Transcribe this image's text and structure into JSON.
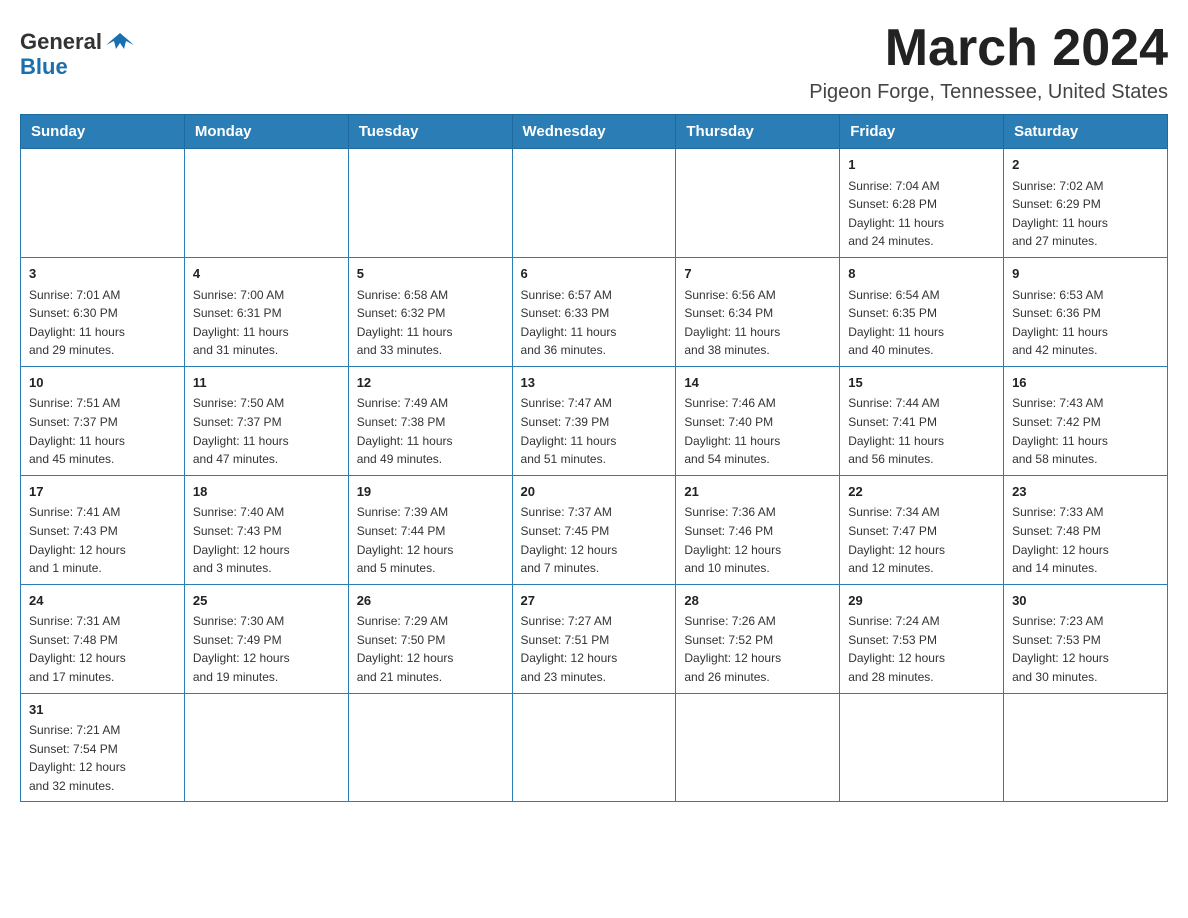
{
  "header": {
    "logo_general": "General",
    "logo_blue": "Blue",
    "month_title": "March 2024",
    "location": "Pigeon Forge, Tennessee, United States"
  },
  "weekdays": [
    "Sunday",
    "Monday",
    "Tuesday",
    "Wednesday",
    "Thursday",
    "Friday",
    "Saturday"
  ],
  "weeks": [
    [
      {
        "day": "",
        "info": ""
      },
      {
        "day": "",
        "info": ""
      },
      {
        "day": "",
        "info": ""
      },
      {
        "day": "",
        "info": ""
      },
      {
        "day": "",
        "info": ""
      },
      {
        "day": "1",
        "info": "Sunrise: 7:04 AM\nSunset: 6:28 PM\nDaylight: 11 hours\nand 24 minutes."
      },
      {
        "day": "2",
        "info": "Sunrise: 7:02 AM\nSunset: 6:29 PM\nDaylight: 11 hours\nand 27 minutes."
      }
    ],
    [
      {
        "day": "3",
        "info": "Sunrise: 7:01 AM\nSunset: 6:30 PM\nDaylight: 11 hours\nand 29 minutes."
      },
      {
        "day": "4",
        "info": "Sunrise: 7:00 AM\nSunset: 6:31 PM\nDaylight: 11 hours\nand 31 minutes."
      },
      {
        "day": "5",
        "info": "Sunrise: 6:58 AM\nSunset: 6:32 PM\nDaylight: 11 hours\nand 33 minutes."
      },
      {
        "day": "6",
        "info": "Sunrise: 6:57 AM\nSunset: 6:33 PM\nDaylight: 11 hours\nand 36 minutes."
      },
      {
        "day": "7",
        "info": "Sunrise: 6:56 AM\nSunset: 6:34 PM\nDaylight: 11 hours\nand 38 minutes."
      },
      {
        "day": "8",
        "info": "Sunrise: 6:54 AM\nSunset: 6:35 PM\nDaylight: 11 hours\nand 40 minutes."
      },
      {
        "day": "9",
        "info": "Sunrise: 6:53 AM\nSunset: 6:36 PM\nDaylight: 11 hours\nand 42 minutes."
      }
    ],
    [
      {
        "day": "10",
        "info": "Sunrise: 7:51 AM\nSunset: 7:37 PM\nDaylight: 11 hours\nand 45 minutes."
      },
      {
        "day": "11",
        "info": "Sunrise: 7:50 AM\nSunset: 7:37 PM\nDaylight: 11 hours\nand 47 minutes."
      },
      {
        "day": "12",
        "info": "Sunrise: 7:49 AM\nSunset: 7:38 PM\nDaylight: 11 hours\nand 49 minutes."
      },
      {
        "day": "13",
        "info": "Sunrise: 7:47 AM\nSunset: 7:39 PM\nDaylight: 11 hours\nand 51 minutes."
      },
      {
        "day": "14",
        "info": "Sunrise: 7:46 AM\nSunset: 7:40 PM\nDaylight: 11 hours\nand 54 minutes."
      },
      {
        "day": "15",
        "info": "Sunrise: 7:44 AM\nSunset: 7:41 PM\nDaylight: 11 hours\nand 56 minutes."
      },
      {
        "day": "16",
        "info": "Sunrise: 7:43 AM\nSunset: 7:42 PM\nDaylight: 11 hours\nand 58 minutes."
      }
    ],
    [
      {
        "day": "17",
        "info": "Sunrise: 7:41 AM\nSunset: 7:43 PM\nDaylight: 12 hours\nand 1 minute."
      },
      {
        "day": "18",
        "info": "Sunrise: 7:40 AM\nSunset: 7:43 PM\nDaylight: 12 hours\nand 3 minutes."
      },
      {
        "day": "19",
        "info": "Sunrise: 7:39 AM\nSunset: 7:44 PM\nDaylight: 12 hours\nand 5 minutes."
      },
      {
        "day": "20",
        "info": "Sunrise: 7:37 AM\nSunset: 7:45 PM\nDaylight: 12 hours\nand 7 minutes."
      },
      {
        "day": "21",
        "info": "Sunrise: 7:36 AM\nSunset: 7:46 PM\nDaylight: 12 hours\nand 10 minutes."
      },
      {
        "day": "22",
        "info": "Sunrise: 7:34 AM\nSunset: 7:47 PM\nDaylight: 12 hours\nand 12 minutes."
      },
      {
        "day": "23",
        "info": "Sunrise: 7:33 AM\nSunset: 7:48 PM\nDaylight: 12 hours\nand 14 minutes."
      }
    ],
    [
      {
        "day": "24",
        "info": "Sunrise: 7:31 AM\nSunset: 7:48 PM\nDaylight: 12 hours\nand 17 minutes."
      },
      {
        "day": "25",
        "info": "Sunrise: 7:30 AM\nSunset: 7:49 PM\nDaylight: 12 hours\nand 19 minutes."
      },
      {
        "day": "26",
        "info": "Sunrise: 7:29 AM\nSunset: 7:50 PM\nDaylight: 12 hours\nand 21 minutes."
      },
      {
        "day": "27",
        "info": "Sunrise: 7:27 AM\nSunset: 7:51 PM\nDaylight: 12 hours\nand 23 minutes."
      },
      {
        "day": "28",
        "info": "Sunrise: 7:26 AM\nSunset: 7:52 PM\nDaylight: 12 hours\nand 26 minutes."
      },
      {
        "day": "29",
        "info": "Sunrise: 7:24 AM\nSunset: 7:53 PM\nDaylight: 12 hours\nand 28 minutes."
      },
      {
        "day": "30",
        "info": "Sunrise: 7:23 AM\nSunset: 7:53 PM\nDaylight: 12 hours\nand 30 minutes."
      }
    ],
    [
      {
        "day": "31",
        "info": "Sunrise: 7:21 AM\nSunset: 7:54 PM\nDaylight: 12 hours\nand 32 minutes."
      },
      {
        "day": "",
        "info": ""
      },
      {
        "day": "",
        "info": ""
      },
      {
        "day": "",
        "info": ""
      },
      {
        "day": "",
        "info": ""
      },
      {
        "day": "",
        "info": ""
      },
      {
        "day": "",
        "info": ""
      }
    ]
  ]
}
